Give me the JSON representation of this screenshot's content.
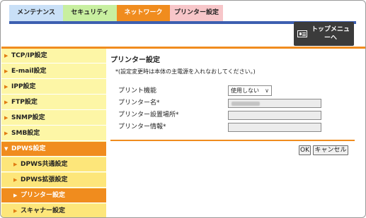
{
  "tabs": {
    "maintenance": "メンテナンス",
    "security": "セキュリティ",
    "network": "ネットワーク",
    "printer_settings": "プリンター設定"
  },
  "top_menu": {
    "label": "トップメニューへ"
  },
  "sidebar": {
    "items": [
      {
        "label": "TCP/IP設定"
      },
      {
        "label": "E-mail設定"
      },
      {
        "label": "IPP設定"
      },
      {
        "label": "FTP設定"
      },
      {
        "label": "SNMP設定"
      },
      {
        "label": "SMB設定"
      },
      {
        "label": "DPWS設定"
      },
      {
        "label": "DPWS共通設定"
      },
      {
        "label": "DPWS拡張設定"
      },
      {
        "label": "プリンター設定"
      },
      {
        "label": "スキャナー設定"
      }
    ]
  },
  "main": {
    "title": "プリンター設定",
    "note": "*(設定変更時は本体の主電源を入れなおしてください。)",
    "print_function": {
      "label": "プリント機能",
      "value": "使用しない"
    },
    "printer_name": {
      "label": "プリンター名*"
    },
    "printer_location": {
      "label": "プリンター設置場所*"
    },
    "printer_info": {
      "label": "プリンター情報*"
    },
    "ok_label": "OK",
    "cancel_label": "キャンセル"
  },
  "colors": {
    "accent_orange": "#f08c1e",
    "nav_blue": "#3d5fb0",
    "sidebar_yellow": "#fdf6a6"
  }
}
